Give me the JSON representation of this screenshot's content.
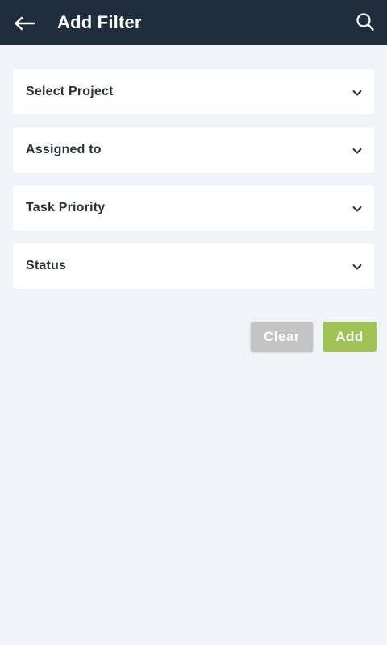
{
  "header": {
    "title": "Add Filter",
    "back_icon": "arrow-left-icon",
    "search_icon": "search-icon",
    "background": "#1f2d3d"
  },
  "filters": [
    {
      "label": "Select Project",
      "icon": "chevron-down-icon"
    },
    {
      "label": "Assigned to",
      "icon": "chevron-down-icon"
    },
    {
      "label": "Task Priority",
      "icon": "chevron-down-icon"
    },
    {
      "label": "Status",
      "icon": "chevron-down-icon"
    }
  ],
  "actions": {
    "clear_label": "Clear",
    "add_label": "Add",
    "clear_color": "#c4c4c4",
    "add_color": "#9fc356"
  },
  "page_background": "#f0f4f9"
}
